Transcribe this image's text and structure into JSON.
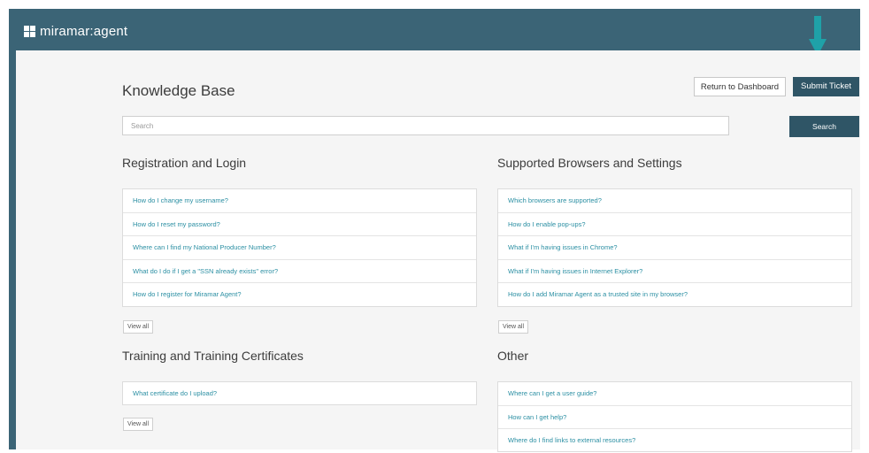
{
  "header": {
    "logo_text": "miramar:agent"
  },
  "colors": {
    "brand": "#3b6476",
    "primary_button": "#2f5566",
    "link": "#2b8fa3",
    "arrow": "#1fa1a8"
  },
  "annotation": {
    "icon": "down-arrow-icon"
  },
  "page": {
    "title": "Knowledge Base"
  },
  "actions": {
    "return_label": "Return to Dashboard",
    "submit_label": "Submit Ticket"
  },
  "search": {
    "placeholder": "Search",
    "button_label": "Search"
  },
  "sections": {
    "registration": {
      "title": "Registration and Login",
      "items": [
        "How do I change my username?",
        "How do I reset my password?",
        "Where can I find my National Producer Number?",
        "What do I do if I get a \"SSN already exists\" error?",
        "How do I register for Miramar Agent?"
      ],
      "view_all": "View all"
    },
    "browsers": {
      "title": "Supported Browsers and Settings",
      "items": [
        "Which browsers are supported?",
        "How do I enable pop-ups?",
        "What if I'm having issues in Chrome?",
        "What if I'm having issues in Internet Explorer?",
        "How do I add Miramar Agent as a trusted site in my browser?"
      ],
      "view_all": "View all"
    },
    "training": {
      "title": "Training and Training Certificates",
      "items": [
        "What certificate do I upload?"
      ],
      "view_all": "View all"
    },
    "other": {
      "title": "Other",
      "items": [
        "Where can I get a user guide?",
        "How can I get help?",
        "Where do I find links to external resources?"
      ]
    }
  }
}
